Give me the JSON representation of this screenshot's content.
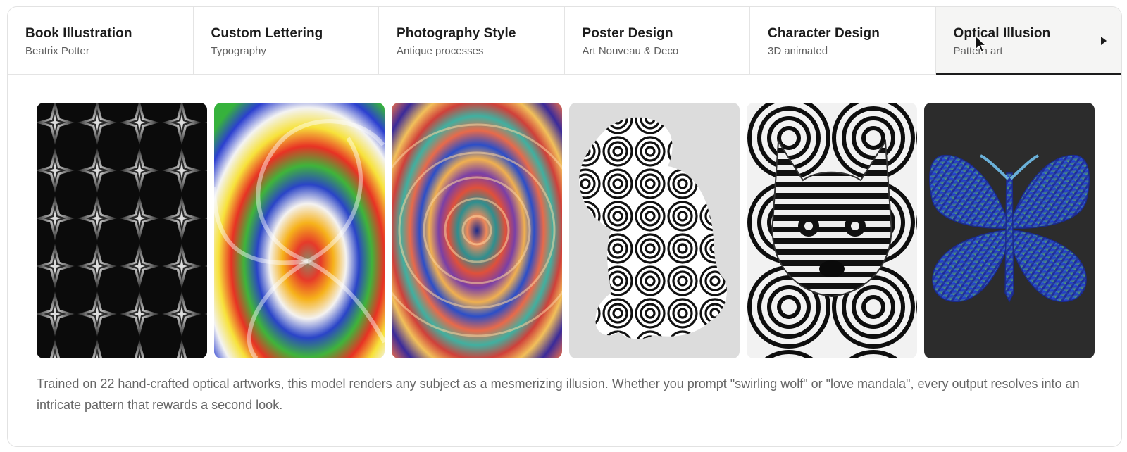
{
  "tabs": [
    {
      "title": "Book Illustration",
      "subtitle": "Beatrix Potter"
    },
    {
      "title": "Custom Lettering",
      "subtitle": "Typography"
    },
    {
      "title": "Photography Style",
      "subtitle": "Antique processes"
    },
    {
      "title": "Poster Design",
      "subtitle": "Art Nouveau & Deco"
    },
    {
      "title": "Character Design",
      "subtitle": "3D animated"
    },
    {
      "title": "Optical Illusion",
      "subtitle": "Pattern art"
    }
  ],
  "active_tab": "Optical Illusion",
  "next_icon": "triangle-right-icon",
  "gallery": {
    "items": [
      {
        "icon": "geometric-star-pattern-image"
      },
      {
        "icon": "rainbow-spiral-image"
      },
      {
        "icon": "heart-mandala-image"
      },
      {
        "icon": "spiral-dog-image"
      },
      {
        "icon": "spiral-wolf-image"
      },
      {
        "icon": "butterfly-moire-image"
      }
    ]
  },
  "description": "Trained on 22 hand-crafted optical artworks, this model renders any subject as a mesmerizing illusion. Whether you prompt \"swirling wolf\" or \"love mandala\", every output resolves into an intricate pattern that rewards a second look.",
  "colors": {
    "active_tab_bg": "#f5f5f4",
    "active_indicator": "#1c1c1c",
    "border": "#e4e4e4",
    "text_secondary": "#666666"
  }
}
